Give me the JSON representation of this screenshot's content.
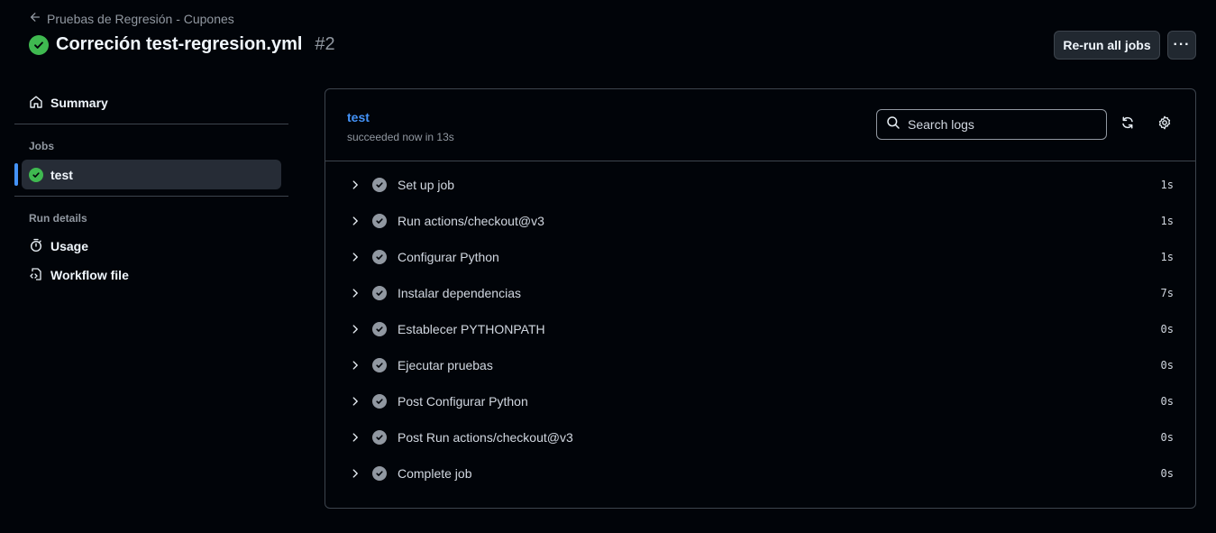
{
  "header": {
    "back_label": "Pruebas de Regresión - Cupones",
    "title": "Correción test-regresion.yml",
    "run_number": "#2",
    "rerun_label": "Re-run all jobs",
    "more_label": "···"
  },
  "sidebar": {
    "summary_label": "Summary",
    "jobs_heading": "Jobs",
    "job_label": "test",
    "run_details_heading": "Run details",
    "usage_label": "Usage",
    "workflow_file_label": "Workflow file"
  },
  "job": {
    "name": "test",
    "status_text": "succeeded now in 13s",
    "search_placeholder": "Search logs",
    "steps": [
      {
        "name": "Set up job",
        "time": "1s"
      },
      {
        "name": "Run actions/checkout@v3",
        "time": "1s"
      },
      {
        "name": "Configurar Python",
        "time": "1s"
      },
      {
        "name": "Instalar dependencias",
        "time": "7s"
      },
      {
        "name": "Establecer PYTHONPATH",
        "time": "0s"
      },
      {
        "name": "Ejecutar pruebas",
        "time": "0s"
      },
      {
        "name": "Post Configurar Python",
        "time": "0s"
      },
      {
        "name": "Post Run actions/checkout@v3",
        "time": "0s"
      },
      {
        "name": "Complete job",
        "time": "0s"
      }
    ]
  },
  "colors": {
    "success": "#3fb950",
    "accent": "#4493f8",
    "background": "#010409"
  }
}
